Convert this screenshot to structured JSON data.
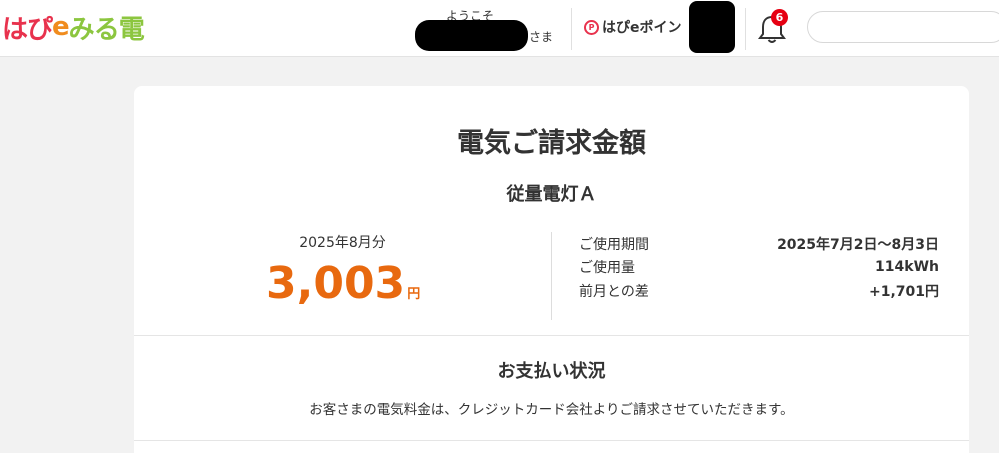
{
  "header": {
    "logo": {
      "chars": [
        {
          "text": "は",
          "color": "#e8324d"
        },
        {
          "text": "ぴ",
          "color": "#e8324d"
        },
        {
          "text": "e",
          "color": "#f08c1e"
        },
        {
          "text": "み",
          "color": "#8cc63f"
        },
        {
          "text": "る",
          "color": "#8cc63f"
        },
        {
          "text": "電",
          "color": "#8cc63f"
        }
      ]
    },
    "welcome": "ようこそ",
    "honorific": "さま",
    "points_label": "はぴeポイン",
    "points_badge": "P",
    "notification_count": "6",
    "bell_icon": "bell-icon"
  },
  "bill": {
    "title": "電気ご請求金額",
    "plan": "従量電灯Ａ",
    "month": "2025年8月分",
    "amount": "3,003",
    "amount_unit": "円",
    "accent_color": "#e8690f",
    "details": [
      {
        "label": "ご使用期間",
        "value": "2025年7月2日～8月3日"
      },
      {
        "label": "ご使用量",
        "value": "114kWh"
      },
      {
        "label": "前月との差",
        "value": "+1,701円"
      }
    ]
  },
  "payment": {
    "title": "お支払い状況",
    "text": "お客さまの電気料金は、クレジットカード会社よりご請求させていただきます。"
  }
}
